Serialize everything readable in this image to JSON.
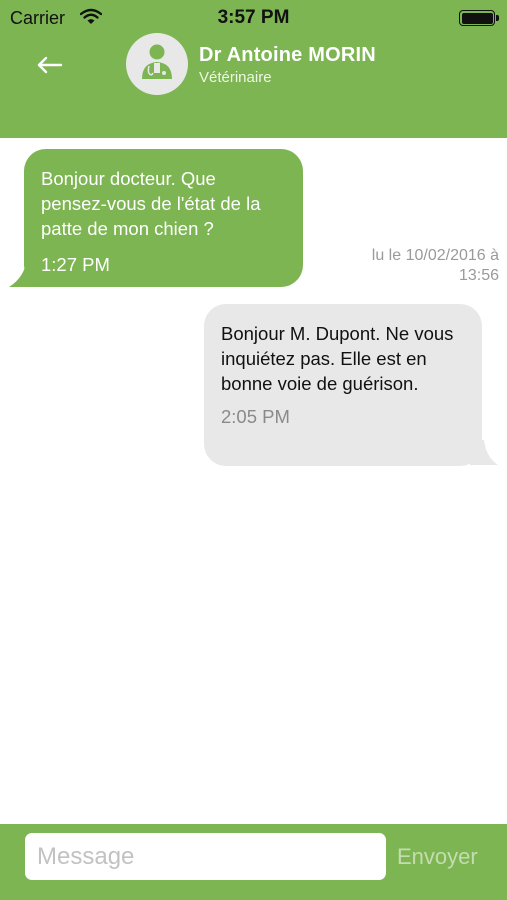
{
  "status_bar": {
    "carrier": "Carrier",
    "time": "3:57 PM"
  },
  "header": {
    "back_icon": "arrow-left-icon",
    "avatar_icon": "doctor-avatar-icon",
    "name": "Dr Antoine MORIN",
    "role": "Vétérinaire"
  },
  "messages": [
    {
      "direction": "incoming",
      "text": "Bonjour docteur. Que pensez-vous de l'état de la patte de mon chien ?",
      "time": "1:27 PM"
    },
    {
      "direction": "outgoing",
      "text": "Bonjour M. Dupont. Ne vous inquiétez pas. Elle est en bonne voie de guérison.",
      "time": "2:05 PM"
    }
  ],
  "date_stamp": "lu le 10/02/2016 à 13:56",
  "composer": {
    "placeholder": "Message",
    "send_label": "Envoyer"
  },
  "colors": {
    "brand_green": "#7cb551",
    "incoming_bubble": "#7cb551",
    "outgoing_bubble": "#e8e8e8"
  }
}
